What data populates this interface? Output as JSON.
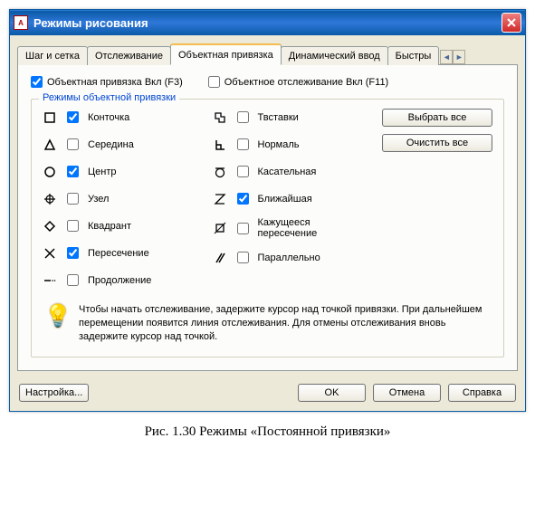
{
  "window": {
    "title": "Режимы рисования",
    "app_icon_text": "A"
  },
  "tabs": {
    "items": [
      {
        "label": "Шаг и сетка",
        "active": false
      },
      {
        "label": "Отслеживание",
        "active": false
      },
      {
        "label": "Объектная привязка",
        "active": true
      },
      {
        "label": "Динамический ввод",
        "active": false
      },
      {
        "label": "Быстры",
        "active": false
      }
    ]
  },
  "main_checks": {
    "osnap_on": "Объектная привязка Вкл (F3)",
    "osnap_on_checked": true,
    "otrack_on": "Объектное отслеживание Вкл (F11)",
    "otrack_on_checked": false
  },
  "fieldset_title": "Режимы объектной привязки",
  "snaps_left": [
    {
      "icon": "endpoint",
      "label": "Конточка",
      "checked": true
    },
    {
      "icon": "midpoint",
      "label": "Середина",
      "checked": false
    },
    {
      "icon": "center",
      "label": "Центр",
      "checked": true
    },
    {
      "icon": "node",
      "label": "Узел",
      "checked": false
    },
    {
      "icon": "quadrant",
      "label": "Квадрант",
      "checked": false
    },
    {
      "icon": "intersection",
      "label": "Пересечение",
      "checked": true
    },
    {
      "icon": "extension",
      "label": "Продолжение",
      "checked": false
    }
  ],
  "snaps_mid": [
    {
      "icon": "insertion",
      "label": "Твставки",
      "checked": false
    },
    {
      "icon": "perpendicular",
      "label": "Нормаль",
      "checked": false
    },
    {
      "icon": "tangent",
      "label": "Касательная",
      "checked": false
    },
    {
      "icon": "nearest",
      "label": "Ближайшая",
      "checked": true
    },
    {
      "icon": "apparent",
      "label": "Кажущееся пересечение",
      "checked": false
    },
    {
      "icon": "parallel",
      "label": "Параллельно",
      "checked": false
    }
  ],
  "buttons": {
    "select_all": "Выбрать все",
    "clear_all": "Очистить все",
    "options": "Настройка...",
    "ok": "OK",
    "cancel": "Отмена",
    "help": "Справка"
  },
  "hint_text": "Чтобы начать отслеживание, задержите курсор над точкой привязки. При дальнейшем перемещении появится линия отслеживания. Для отмены отслеживания вновь задержите курсор над точкой.",
  "caption": "Рис. 1.30 Режимы «Постоянной привязки»"
}
